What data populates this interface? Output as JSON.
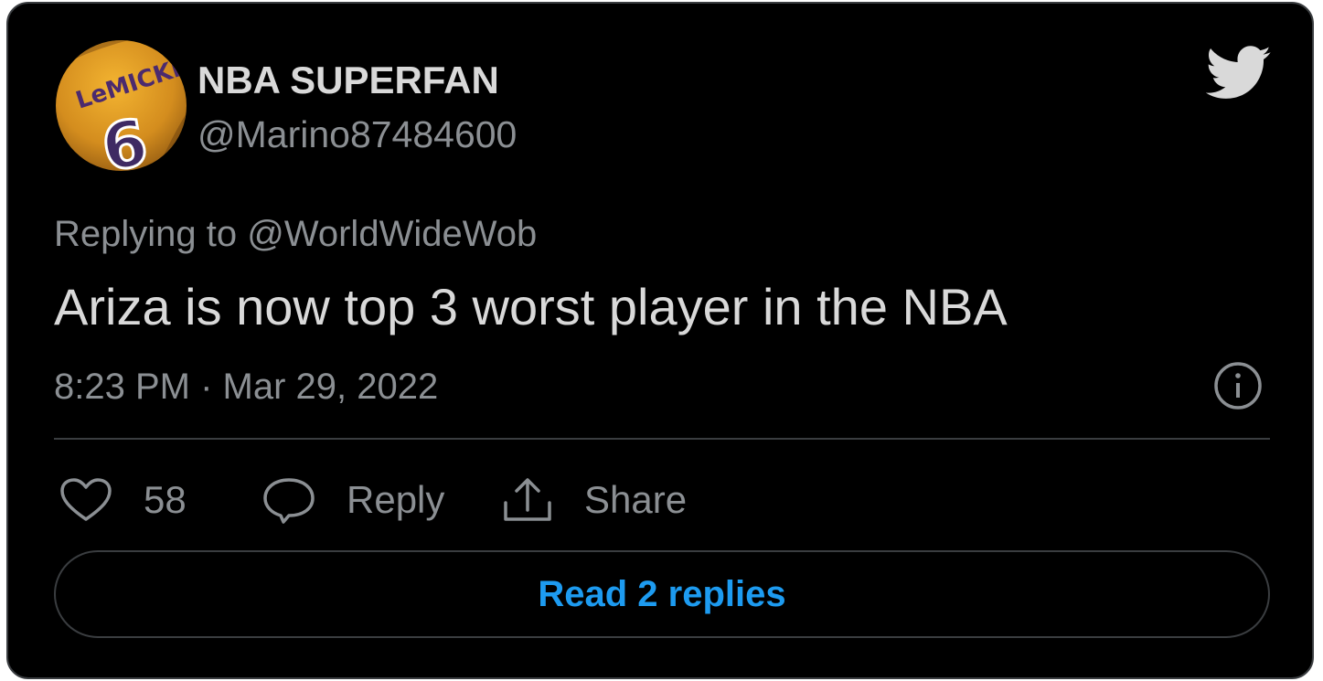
{
  "author": {
    "display_name": "NBA SUPERFAN",
    "handle": "@Marino87484600",
    "avatar_icon": "jersey-avatar",
    "avatar_jersey_name": "LeMICKEY",
    "avatar_jersey_number": "6"
  },
  "tweet": {
    "replying_to": "Replying to @WorldWideWob",
    "text": "Ariza is now top 3 worst player in the NBA",
    "timestamp": "8:23 PM · Mar 29, 2022"
  },
  "actions": {
    "like_icon": "heart-icon",
    "like_count": "58",
    "reply_icon": "speech-bubble-icon",
    "reply_label": "Reply",
    "share_icon": "upload-icon",
    "share_label": "Share"
  },
  "read_replies_label": "Read 2 replies",
  "colors": {
    "background": "#000000",
    "primary_text": "#d9d9d9",
    "secondary_text": "#8b8f93",
    "border": "#3a3d40",
    "accent": "#1d9bf0"
  }
}
